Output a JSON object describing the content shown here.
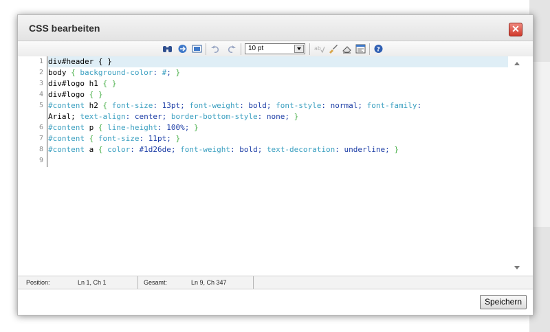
{
  "dialog": {
    "title": "CSS bearbeiten",
    "close_label": "✕"
  },
  "toolbar": {
    "icons": [
      "binoculars-icon",
      "goto-line-icon",
      "fullscreen-icon",
      "undo-icon",
      "redo-icon",
      "spellcheck-icon",
      "brush-icon",
      "eraser-icon",
      "syntax-toggle-icon",
      "help-icon"
    ],
    "font_size": "10 pt"
  },
  "editor": {
    "line_numbers": [
      "1",
      "2",
      "3",
      "4",
      "5",
      "",
      "6",
      "7",
      "8",
      "9"
    ],
    "lines": [
      [
        {
          "t": "div#header { }",
          "c": "sel"
        }
      ],
      [
        {
          "t": "body ",
          "c": "sel"
        },
        {
          "t": "{ ",
          "c": "br"
        },
        {
          "t": "background-color",
          "c": "prop"
        },
        {
          "t": ": ",
          "c": "val"
        },
        {
          "t": "#",
          "c": "hash"
        },
        {
          "t": ";",
          "c": "val"
        },
        {
          "t": " }",
          "c": "br"
        }
      ],
      [
        {
          "t": "div#logo h1 ",
          "c": "sel"
        },
        {
          "t": "{ }",
          "c": "br"
        }
      ],
      [
        {
          "t": "div#logo ",
          "c": "sel"
        },
        {
          "t": "{ }",
          "c": "br"
        }
      ],
      [
        {
          "t": "#content",
          "c": "hash"
        },
        {
          "t": " h2 ",
          "c": "sel"
        },
        {
          "t": "{ ",
          "c": "br"
        },
        {
          "t": "font-size",
          "c": "prop"
        },
        {
          "t": ": 13pt; ",
          "c": "val"
        },
        {
          "t": "font-weight",
          "c": "prop"
        },
        {
          "t": ": bold; ",
          "c": "val"
        },
        {
          "t": "font-style",
          "c": "prop"
        },
        {
          "t": ": normal; ",
          "c": "val"
        },
        {
          "t": "font-family",
          "c": "prop"
        },
        {
          "t": ":",
          "c": "val"
        }
      ],
      [
        {
          "t": "Arial; ",
          "c": "sel"
        },
        {
          "t": "text-align",
          "c": "prop"
        },
        {
          "t": ": center; ",
          "c": "val"
        },
        {
          "t": "border-bottom-style",
          "c": "prop"
        },
        {
          "t": ": none; ",
          "c": "val"
        },
        {
          "t": "}",
          "c": "br"
        }
      ],
      [
        {
          "t": "#content",
          "c": "hash"
        },
        {
          "t": " p ",
          "c": "sel"
        },
        {
          "t": "{ ",
          "c": "br"
        },
        {
          "t": "line-height",
          "c": "prop"
        },
        {
          "t": ": 100%; ",
          "c": "val"
        },
        {
          "t": "}",
          "c": "br"
        }
      ],
      [
        {
          "t": "#content",
          "c": "hash"
        },
        {
          "t": " { ",
          "c": "br"
        },
        {
          "t": "font-size",
          "c": "prop"
        },
        {
          "t": ": 11pt; ",
          "c": "val"
        },
        {
          "t": "}",
          "c": "br"
        }
      ],
      [
        {
          "t": "#content",
          "c": "hash"
        },
        {
          "t": " a ",
          "c": "sel"
        },
        {
          "t": "{ ",
          "c": "br"
        },
        {
          "t": "color",
          "c": "prop"
        },
        {
          "t": ": #1d26de; ",
          "c": "val"
        },
        {
          "t": "font-weight",
          "c": "prop"
        },
        {
          "t": ": bold; ",
          "c": "val"
        },
        {
          "t": "text-decoration",
          "c": "prop"
        },
        {
          "t": ": underline; ",
          "c": "val"
        },
        {
          "t": "}",
          "c": "br"
        }
      ],
      []
    ]
  },
  "statusbar": {
    "position_label": "Position:",
    "position_value": "Ln 1, Ch 1",
    "total_label": "Gesamt:",
    "total_value": "Ln 9, Ch 347"
  },
  "footer": {
    "save_label": "Speichern"
  },
  "colors": {
    "close_button": "#d03a2c",
    "active_line": "#dfeef6",
    "selector": "#000000",
    "brace": "#4ab04a",
    "property": "#3a9fc0",
    "value": "#1d3ea6"
  }
}
